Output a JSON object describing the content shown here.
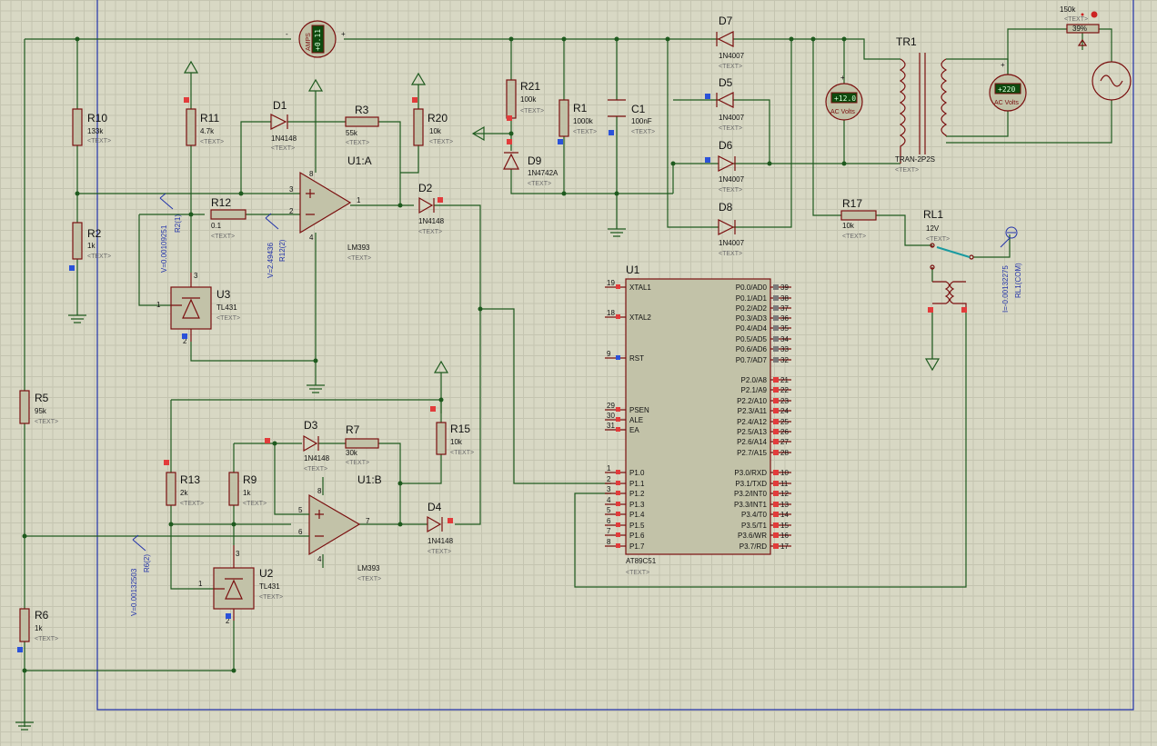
{
  "components": {
    "R10": {
      "ref": "R10",
      "value": "133k",
      "text": "<TEXT>"
    },
    "R2": {
      "ref": "R2",
      "value": "1k",
      "text": "<TEXT>"
    },
    "R11": {
      "ref": "R11",
      "value": "4.7k",
      "text": "<TEXT>"
    },
    "R12": {
      "ref": "R12",
      "value": "0.1",
      "text": "<TEXT>"
    },
    "R3": {
      "ref": "R3",
      "value": "55k",
      "text": "<TEXT>"
    },
    "R20": {
      "ref": "R20",
      "value": "10k",
      "text": "<TEXT>"
    },
    "R21": {
      "ref": "R21",
      "value": "100k",
      "text": "<TEXT>"
    },
    "R1": {
      "ref": "R1",
      "value": "1000k",
      "text": "<TEXT>"
    },
    "C1": {
      "ref": "C1",
      "value": "100nF",
      "text": "<TEXT>"
    },
    "D1": {
      "ref": "D1",
      "value": "1N4148",
      "text": "<TEXT>"
    },
    "D2": {
      "ref": "D2",
      "value": "1N4148",
      "text": "<TEXT>"
    },
    "D3": {
      "ref": "D3",
      "value": "1N4148",
      "text": "<TEXT>"
    },
    "D4": {
      "ref": "D4",
      "value": "1N4148",
      "text": "<TEXT>"
    },
    "D5": {
      "ref": "D5",
      "value": "1N4007",
      "text": "<TEXT>"
    },
    "D6": {
      "ref": "D6",
      "value": "1N4007",
      "text": "<TEXT>"
    },
    "D7": {
      "ref": "D7",
      "value": "1N4007",
      "text": "<TEXT>"
    },
    "D8": {
      "ref": "D8",
      "value": "1N4007",
      "text": "<TEXT>"
    },
    "D9": {
      "ref": "D9",
      "value": "1N4742A",
      "text": "<TEXT>"
    },
    "U1A": {
      "ref": "U1:A",
      "value": "LM393",
      "text": "<TEXT>"
    },
    "U1B": {
      "ref": "U1:B",
      "value": "LM393",
      "text": "<TEXT>"
    },
    "U3": {
      "ref": "U3",
      "value": "TL431",
      "text": "<TEXT>"
    },
    "U2": {
      "ref": "U2",
      "value": "TL431",
      "text": "<TEXT>"
    },
    "R5": {
      "ref": "R5",
      "value": "95k",
      "text": "<TEXT>"
    },
    "R6": {
      "ref": "R6",
      "value": "1k",
      "text": "<TEXT>"
    },
    "R13": {
      "ref": "R13",
      "value": "2k",
      "text": "<TEXT>"
    },
    "R9": {
      "ref": "R9",
      "value": "1k",
      "text": "<TEXT>"
    },
    "R7": {
      "ref": "R7",
      "value": "30k",
      "text": "<TEXT>"
    },
    "R15": {
      "ref": "R15",
      "value": "10k",
      "text": "<TEXT>"
    },
    "R17": {
      "ref": "R17",
      "value": "10k",
      "text": "<TEXT>"
    },
    "TR1": {
      "ref": "TR1",
      "value": "TRAN-2P2S",
      "text": "<TEXT>"
    },
    "RL1": {
      "ref": "RL1",
      "value": "12V",
      "text": "<TEXT>"
    },
    "POT": {
      "value": "150k",
      "text": "<TEXT>",
      "percent": "39%"
    },
    "U1": {
      "ref": "U1",
      "value": "AT89C51",
      "text": "<TEXT>"
    }
  },
  "meters": {
    "dc": {
      "label": "AMPS",
      "reading": "+0.11"
    },
    "ac1": {
      "label": "AC Volts",
      "reading": "+12.0"
    },
    "ac2": {
      "label": "AC Volts",
      "reading": "+220"
    }
  },
  "probes": {
    "r2": {
      "value": "V=0.00109251",
      "name": "R2(1)"
    },
    "r12": {
      "value": "V=2.49436",
      "name": "R12(2)"
    },
    "r6": {
      "value": "V=0.00132503",
      "name": "R6(2)"
    },
    "rl1": {
      "value": "I=-0.00132275",
      "name": "RL1(COM)"
    }
  },
  "opamp_pins": {
    "p3": "3",
    "p2": "2",
    "p1": "1",
    "p8": "8",
    "p4": "4",
    "p5": "5",
    "p6": "6",
    "p7": "7",
    "p8b": "8",
    "p4b": "4"
  },
  "tl431_pins": {
    "u3_3": "3",
    "u3_1": "1",
    "u3_2": "2",
    "u2_3": "3",
    "u2_1": "1",
    "u2_2": "2"
  },
  "mcu_left": [
    {
      "num": "19",
      "name": "XTAL1"
    },
    {
      "num": "18",
      "name": "XTAL2"
    },
    {
      "num": "9",
      "name": "RST"
    },
    {
      "num": "29",
      "name": "PSEN"
    },
    {
      "num": "30",
      "name": "ALE"
    },
    {
      "num": "31",
      "name": "EA"
    },
    {
      "num": "1",
      "name": "P1.0"
    },
    {
      "num": "2",
      "name": "P1.1"
    },
    {
      "num": "3",
      "name": "P1.2"
    },
    {
      "num": "4",
      "name": "P1.3"
    },
    {
      "num": "5",
      "name": "P1.4"
    },
    {
      "num": "6",
      "name": "P1.5"
    },
    {
      "num": "7",
      "name": "P1.6"
    },
    {
      "num": "8",
      "name": "P1.7"
    }
  ],
  "mcu_right": [
    {
      "num": "39",
      "name": "P0.0/AD0"
    },
    {
      "num": "38",
      "name": "P0.1/AD1"
    },
    {
      "num": "37",
      "name": "P0.2/AD2"
    },
    {
      "num": "36",
      "name": "P0.3/AD3"
    },
    {
      "num": "35",
      "name": "P0.4/AD4"
    },
    {
      "num": "34",
      "name": "P0.5/AD5"
    },
    {
      "num": "33",
      "name": "P0.6/AD6"
    },
    {
      "num": "32",
      "name": "P0.7/AD7"
    },
    {
      "num": "21",
      "name": "P2.0/A8"
    },
    {
      "num": "22",
      "name": "P2.1/A9"
    },
    {
      "num": "23",
      "name": "P2.2/A10"
    },
    {
      "num": "24",
      "name": "P2.3/A11"
    },
    {
      "num": "25",
      "name": "P2.4/A12"
    },
    {
      "num": "26",
      "name": "P2.5/A13"
    },
    {
      "num": "27",
      "name": "P2.6/A14"
    },
    {
      "num": "28",
      "name": "P2.7/A15"
    },
    {
      "num": "10",
      "name": "P3.0/RXD"
    },
    {
      "num": "11",
      "name": "P3.1/TXD"
    },
    {
      "num": "12",
      "name": "P3.2/INT0"
    },
    {
      "num": "13",
      "name": "P3.3/INT1"
    },
    {
      "num": "14",
      "name": "P3.4/T0"
    },
    {
      "num": "15",
      "name": "P3.5/T1"
    },
    {
      "num": "16",
      "name": "P3.6/WR"
    },
    {
      "num": "17",
      "name": "P3.7/RD"
    }
  ]
}
